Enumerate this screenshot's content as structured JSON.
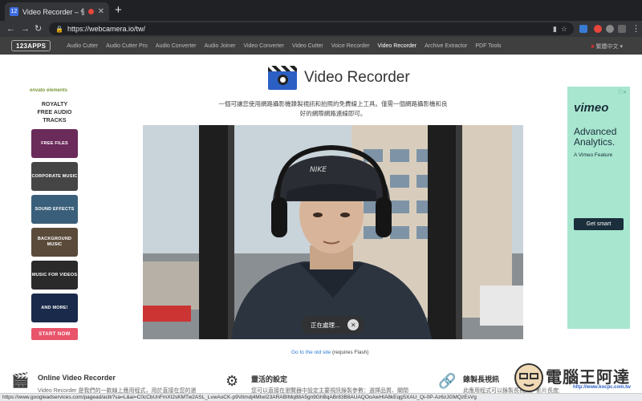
{
  "browser": {
    "tab_title": "Video Recorder – 使用網路",
    "tab_favicon": "12",
    "url": "https://webcamera.io/tw/",
    "status_url": "https://www.googleadservices.com/pagead/aclk?sa=L&ai=C0cCbUnFmXI2sKMTw2ASL_LvwAoCK-p9Vitmdj4MIwI23ARABIMq88A5gn9GhBqABr83B8AUAQOoAwHIA8kEqgSXAU_Qi-0P-Az6zJGMQzEsVg"
  },
  "sitenav": {
    "logo": "123APPS",
    "links": [
      "Audio Cutter",
      "Audio Cutter Pro",
      "Audio Converter",
      "Audio Joiner",
      "Video Converter",
      "Video Cutter",
      "Voice Recorder",
      "Video Recorder",
      "Archive Extractor",
      "PDF Tools"
    ],
    "active_index": 7,
    "language": "繁體中文"
  },
  "ad_left": {
    "brand": "envato elements",
    "title_lines": [
      "ROYALTY",
      "FREE AUDIO",
      "TRACKS"
    ],
    "tiles": [
      {
        "label": "FREE FILES",
        "color": "#6a2a5a"
      },
      {
        "label": "CORPORATE MUSIC",
        "color": "#454545"
      },
      {
        "label": "SOUND EFFECTS",
        "color": "#3a5f7a"
      },
      {
        "label": "BACKGROUND MUSIC",
        "color": "#5a4a3a"
      },
      {
        "label": "MUSIC FOR VIDEOS",
        "color": "#2a2a2a"
      },
      {
        "label": "AND MORE!",
        "color": "#1a2a4a"
      }
    ],
    "cta": "START NOW"
  },
  "ad_right": {
    "brand": "vimeo",
    "headline_lines": [
      "Advanced",
      "Analytics."
    ],
    "sub": "A Vimeo Feature",
    "cta": "Get smart"
  },
  "main": {
    "title": "Video Recorder",
    "description": "一個可讓您使用網路攝影機錄製視訊和拍照的免費線上工具。僅需一個網路攝影機和良好的網際網路連線即可。",
    "processing_text": "正在處理...",
    "old_site_link": "Go to the old site",
    "old_site_note": "(requires Flash)"
  },
  "features": [
    {
      "icon": "camera-clapper-icon",
      "title": "Online Video Recorder",
      "text": "Video Recorder 是我們的一款線上應用程式，用於直接在您的瀏"
    },
    {
      "icon": "gear-icon",
      "title": "靈活的設定",
      "text": "您可以直接在瀏覽器中設定主要視訊錄製參數：選擇品質、關閉"
    },
    {
      "icon": "clip-icon",
      "title": "錄製長視訊",
      "text": "此應用程式可以錄製長視訊，影片長度無限制"
    }
  ],
  "watermark": {
    "text": "電腦王阿達",
    "sub": "http://www.kocpc.com.tw"
  }
}
